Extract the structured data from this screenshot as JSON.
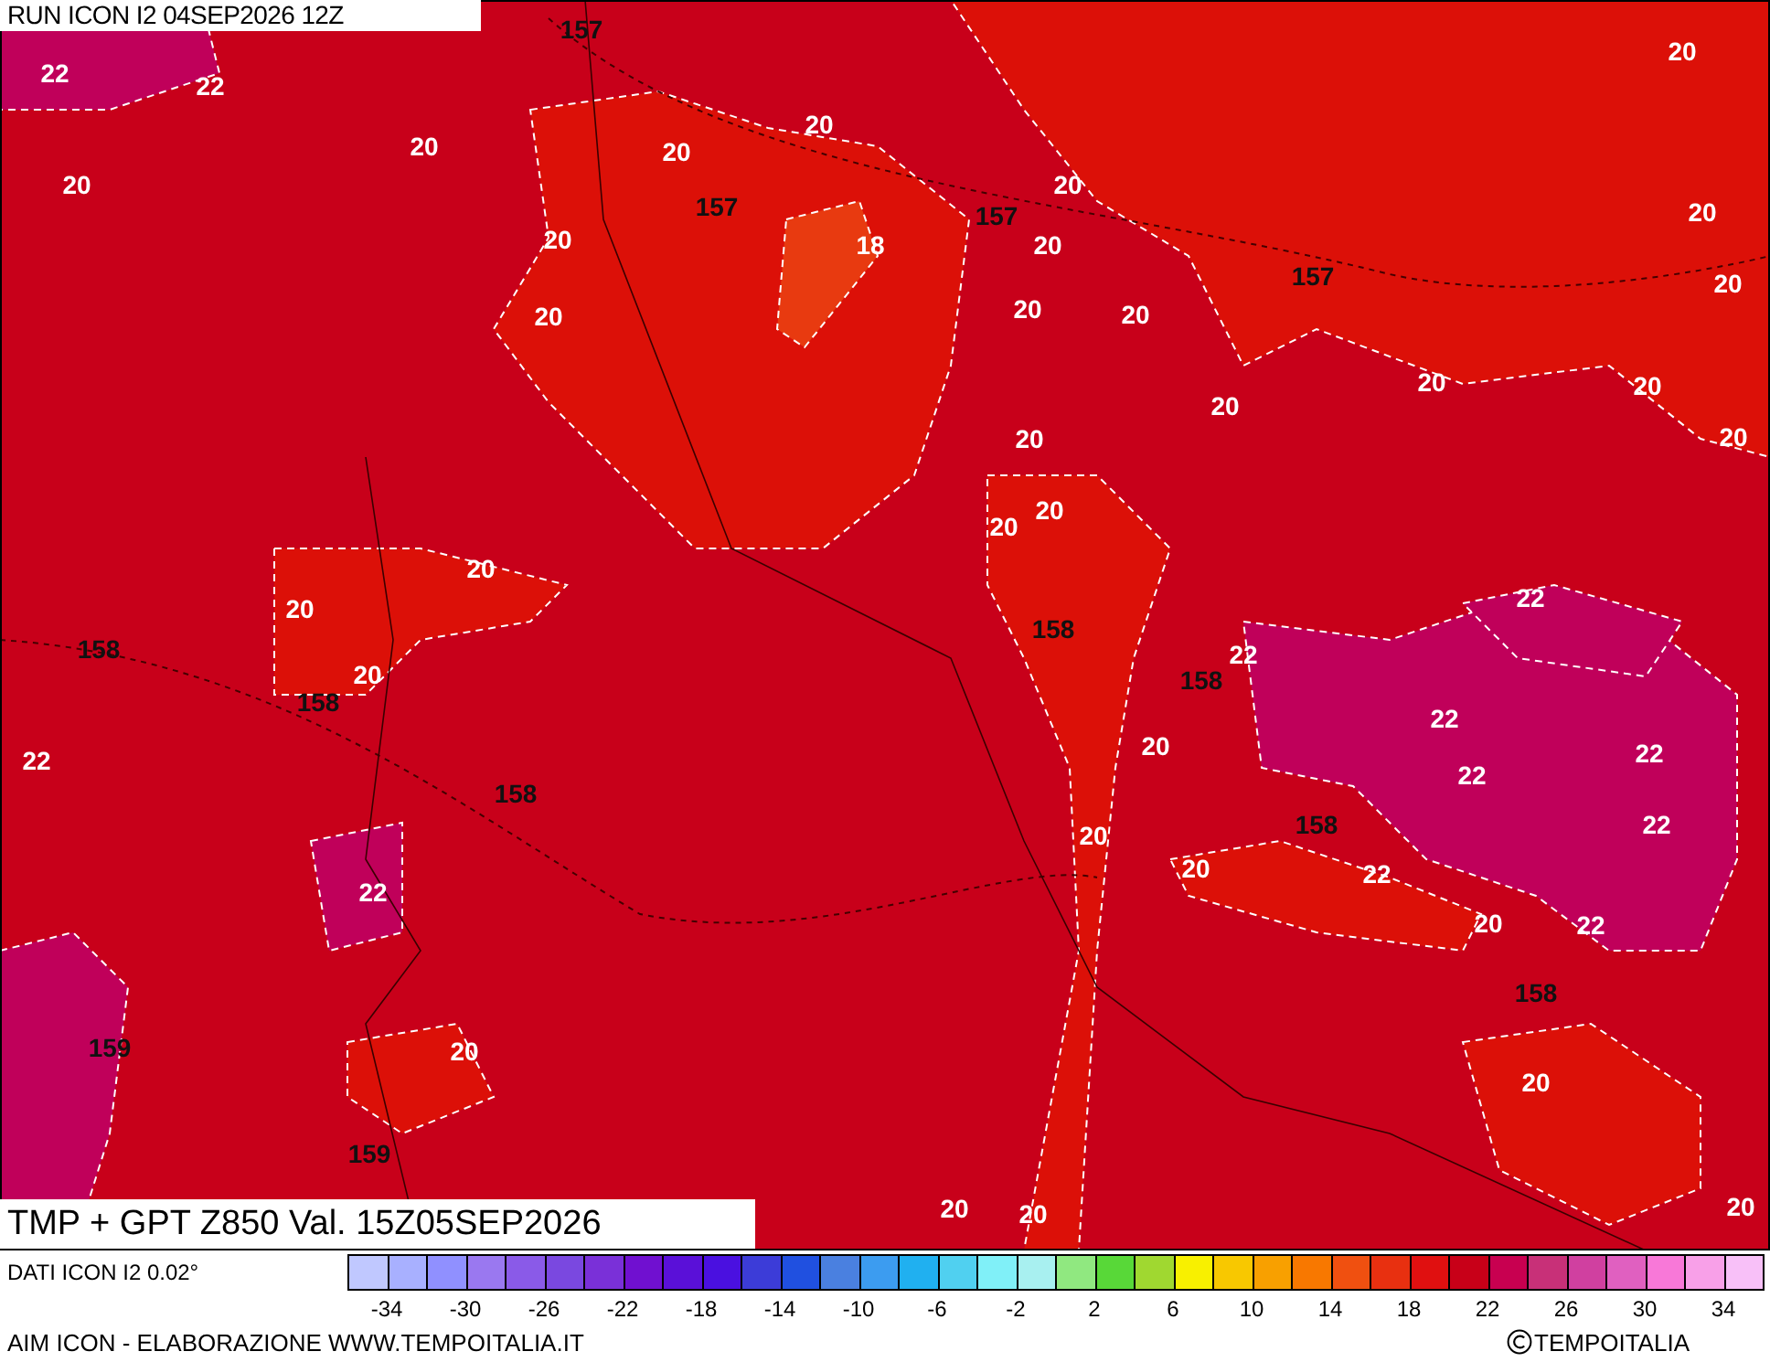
{
  "run_title": "RUN ICON I2 04SEP2026 12Z",
  "field_title": "TMP + GPT Z850 Val. 15Z05SEP2026",
  "map": {
    "labels": [
      {
        "text": "22",
        "kind": "temperature"
      },
      {
        "text": "22",
        "kind": "temperature"
      },
      {
        "text": "20",
        "kind": "temperature"
      },
      {
        "text": "20",
        "kind": "temperature"
      },
      {
        "text": "20",
        "kind": "temperature"
      },
      {
        "text": "20",
        "kind": "temperature"
      },
      {
        "text": "20",
        "kind": "temperature"
      },
      {
        "text": "20",
        "kind": "temperature"
      },
      {
        "text": "20",
        "kind": "temperature"
      },
      {
        "text": "20",
        "kind": "temperature"
      },
      {
        "text": "20",
        "kind": "temperature"
      },
      {
        "text": "20",
        "kind": "temperature"
      },
      {
        "text": "20",
        "kind": "temperature"
      },
      {
        "text": "20",
        "kind": "temperature"
      },
      {
        "text": "20",
        "kind": "temperature"
      },
      {
        "text": "20",
        "kind": "temperature"
      },
      {
        "text": "20",
        "kind": "temperature"
      },
      {
        "text": "20",
        "kind": "temperature"
      },
      {
        "text": "20",
        "kind": "temperature"
      },
      {
        "text": "20",
        "kind": "temperature"
      },
      {
        "text": "20",
        "kind": "temperature"
      },
      {
        "text": "20",
        "kind": "temperature"
      },
      {
        "text": "20",
        "kind": "temperature"
      },
      {
        "text": "20",
        "kind": "temperature"
      },
      {
        "text": "20",
        "kind": "temperature"
      },
      {
        "text": "20",
        "kind": "temperature"
      },
      {
        "text": "20",
        "kind": "temperature"
      },
      {
        "text": "20",
        "kind": "temperature"
      },
      {
        "text": "20",
        "kind": "temperature"
      },
      {
        "text": "20",
        "kind": "temperature"
      },
      {
        "text": "20",
        "kind": "temperature"
      },
      {
        "text": "20",
        "kind": "temperature"
      },
      {
        "text": "20",
        "kind": "temperature"
      },
      {
        "text": "20",
        "kind": "temperature"
      },
      {
        "text": "22",
        "kind": "temperature"
      },
      {
        "text": "22",
        "kind": "temperature"
      },
      {
        "text": "22",
        "kind": "temperature"
      },
      {
        "text": "22",
        "kind": "temperature"
      },
      {
        "text": "22",
        "kind": "temperature"
      },
      {
        "text": "22",
        "kind": "temperature"
      },
      {
        "text": "22",
        "kind": "temperature"
      },
      {
        "text": "22",
        "kind": "temperature"
      },
      {
        "text": "22",
        "kind": "temperature"
      },
      {
        "text": "22",
        "kind": "temperature"
      },
      {
        "text": "18",
        "kind": "temperature"
      },
      {
        "text": "157",
        "kind": "height"
      },
      {
        "text": "157",
        "kind": "height"
      },
      {
        "text": "157",
        "kind": "height"
      },
      {
        "text": "157",
        "kind": "height"
      },
      {
        "text": "158",
        "kind": "height"
      },
      {
        "text": "158",
        "kind": "height"
      },
      {
        "text": "158",
        "kind": "height"
      },
      {
        "text": "158",
        "kind": "height"
      },
      {
        "text": "158",
        "kind": "height"
      },
      {
        "text": "158",
        "kind": "height"
      },
      {
        "text": "158",
        "kind": "height"
      },
      {
        "text": "159",
        "kind": "height"
      },
      {
        "text": "159",
        "kind": "height"
      }
    ]
  },
  "legend": {
    "source": "DATI ICON I2 0.02°",
    "swatches": [
      {
        "color": "#c0c8ff"
      },
      {
        "color": "#a8b0ff"
      },
      {
        "color": "#9090ff"
      },
      {
        "color": "#9a78f0"
      },
      {
        "color": "#8a5ae8"
      },
      {
        "color": "#7a48e0"
      },
      {
        "color": "#7a30d8"
      },
      {
        "color": "#7010d0"
      },
      {
        "color": "#5a10d8"
      },
      {
        "color": "#4a10e0"
      },
      {
        "color": "#3c3cd8"
      },
      {
        "color": "#2050e0"
      },
      {
        "color": "#4a80e0"
      },
      {
        "color": "#3c9cf0"
      },
      {
        "color": "#20b0f0"
      },
      {
        "color": "#50d0f0"
      },
      {
        "color": "#80f0f8"
      },
      {
        "color": "#a8f0f0"
      },
      {
        "color": "#90e880"
      },
      {
        "color": "#58d838"
      },
      {
        "color": "#a0d830"
      },
      {
        "color": "#f8f000"
      },
      {
        "color": "#f8c800"
      },
      {
        "color": "#f8a000"
      },
      {
        "color": "#f87800"
      },
      {
        "color": "#f05010"
      },
      {
        "color": "#e83010"
      },
      {
        "color": "#e01010"
      },
      {
        "color": "#c80018"
      },
      {
        "color": "#c80050"
      },
      {
        "color": "#c83078"
      },
      {
        "color": "#d040a0"
      },
      {
        "color": "#e060c0"
      },
      {
        "color": "#f878d8"
      },
      {
        "color": "#f8a0e8"
      },
      {
        "color": "#f8c0f8"
      }
    ],
    "ticks": [
      "-34",
      "-30",
      "-26",
      "-22",
      "-18",
      "-14",
      "-10",
      "-6",
      "-2",
      "2",
      "6",
      "10",
      "14",
      "18",
      "22",
      "26",
      "30",
      "34"
    ]
  },
  "footer": {
    "credit": "AIM ICON - ELABORAZIONE WWW.TEMPOITALIA.IT",
    "copyright": "TEMPOITALIA"
  }
}
